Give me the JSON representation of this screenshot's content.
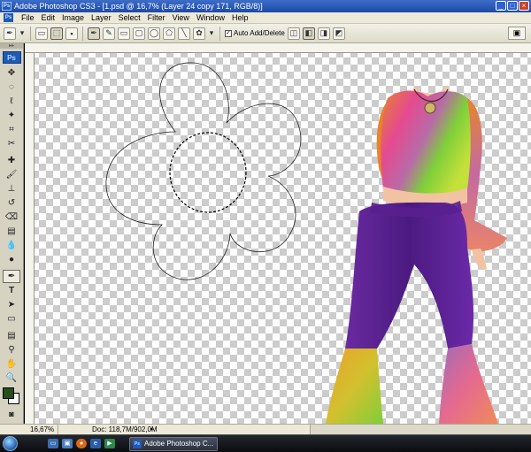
{
  "titlebar": {
    "title": "Adobe Photoshop CS3 - [1.psd @ 16,7% (Layer 24 copy 171, RGB/8)]",
    "icon": "ps-icon"
  },
  "menubar": {
    "items": [
      "File",
      "Edit",
      "Image",
      "Layer",
      "Select",
      "Filter",
      "View",
      "Window",
      "Help"
    ]
  },
  "optionsbar": {
    "auto_add_delete_label": "Auto Add/Delete",
    "auto_add_delete_checked": true
  },
  "tools": {
    "badge": "Ps",
    "foreground_color": "#274d1b",
    "background_color": "#ffffff"
  },
  "statusbar": {
    "zoom": "16,67%",
    "doc_size": "Doc: 118,7M/902,0M"
  },
  "taskbar": {
    "active_task_label": "Adobe Photoshop C..."
  },
  "colors": {
    "pants": "#5a1f8f",
    "shirt_green": "#7fcf3a",
    "shirt_orange": "#e8842c",
    "shirt_pink": "#e54a8f",
    "skin": "#f2c3a3"
  }
}
